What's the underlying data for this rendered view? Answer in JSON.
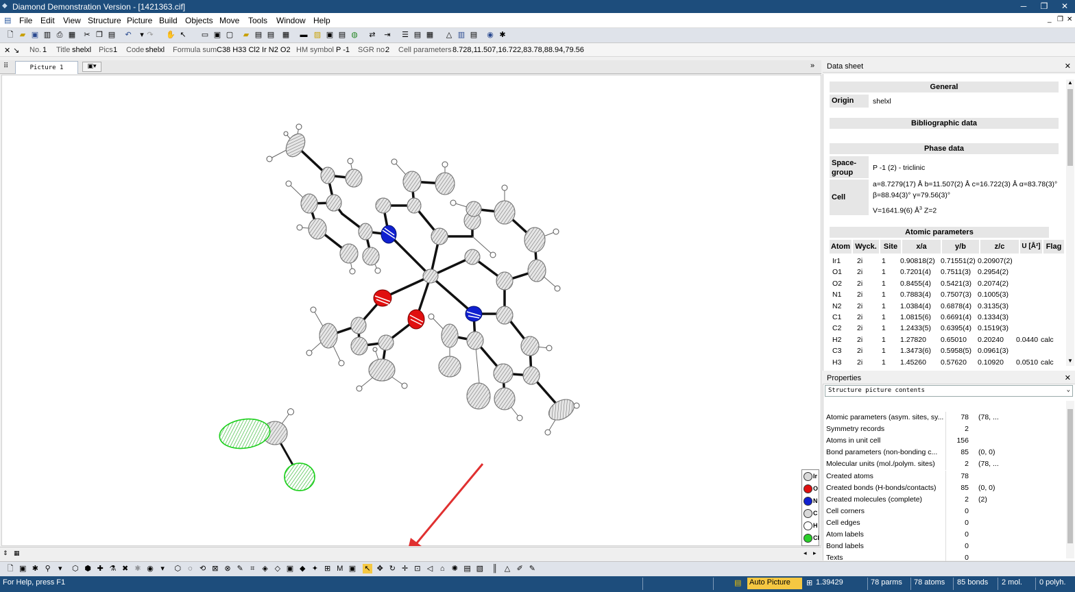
{
  "app": {
    "title": "Diamond Demonstration Version - [1421363.cif]",
    "menu": [
      "File",
      "Edit",
      "View",
      "Structure",
      "Picture",
      "Build",
      "Objects",
      "Move",
      "Tools",
      "Window",
      "Help"
    ]
  },
  "info": {
    "no_label": "No.",
    "no": "1",
    "title_label": "Title",
    "title": "shelxl",
    "pics_label": "Pics",
    "pics": "1",
    "code_label": "Code",
    "code": "shelxl",
    "formula_label": "Formula sum",
    "formula": "C38 H33 Cl2 Ir N2 O2",
    "hm_label": "HM symbol",
    "hm": "P -1",
    "sgr_label": "SGR no.",
    "sgr": "2",
    "cell_label": "Cell parameters",
    "cell": "8.728,11.507,16.722,83.78,88.94,79.56"
  },
  "tab": {
    "label": "Picture 1"
  },
  "datasheet": {
    "title": "Data sheet",
    "general": "General",
    "origin_label": "Origin",
    "origin": "shelxl",
    "biblio": "Bibliographic data",
    "phase": "Phase data",
    "sg_label": "Space-group",
    "sg": "P -1 (2) - triclinic",
    "cell_label": "Cell",
    "cell_line1": "a=8.7279(17) Å b=11.507(2) Å c=16.722(3) Å α=83.78(3)°",
    "cell_line2": "β=88.94(3)° γ=79.56(3)°",
    "cell_line3": "V=1641.9(6) Å",
    "cell_line3_sup": "3",
    "cell_line3_z": " Z=2",
    "atomic": "Atomic parameters",
    "headers": [
      "Atom",
      "Wyck.",
      "Site",
      "x/a",
      "y/b",
      "z/c",
      "U [Å²]",
      "Flag"
    ],
    "rows": [
      [
        "Ir1",
        "2i",
        "1",
        "0.90818(2)",
        "0.71551(2)",
        "0.20907(2)",
        "",
        ""
      ],
      [
        "O1",
        "2i",
        "1",
        "0.7201(4)",
        "0.7511(3)",
        "0.2954(2)",
        "",
        ""
      ],
      [
        "O2",
        "2i",
        "1",
        "0.8455(4)",
        "0.5421(3)",
        "0.2074(2)",
        "",
        ""
      ],
      [
        "N1",
        "2i",
        "1",
        "0.7883(4)",
        "0.7507(3)",
        "0.1005(3)",
        "",
        ""
      ],
      [
        "N2",
        "2i",
        "1",
        "1.0384(4)",
        "0.6878(4)",
        "0.3135(3)",
        "",
        ""
      ],
      [
        "C1",
        "2i",
        "1",
        "1.0815(6)",
        "0.6691(4)",
        "0.1334(3)",
        "",
        ""
      ],
      [
        "C2",
        "2i",
        "1",
        "1.2433(5)",
        "0.6395(4)",
        "0.1519(3)",
        "",
        ""
      ],
      [
        "H2",
        "2i",
        "1",
        "1.27820",
        "0.65010",
        "0.20240",
        "0.0440",
        "calc"
      ],
      [
        "C3",
        "2i",
        "1",
        "1.3473(6)",
        "0.5958(5)",
        "0.0961(3)",
        "",
        ""
      ],
      [
        "H3",
        "2i",
        "1",
        "1.45260",
        "0.57620",
        "0.10920",
        "0.0510",
        "calc"
      ]
    ]
  },
  "properties": {
    "title": "Properties",
    "combo": "Structure picture contents",
    "items": [
      [
        "Atomic parameters (asym. sites, sy...",
        "78",
        "(78, ..."
      ],
      [
        "Symmetry records",
        "2",
        ""
      ],
      [
        "Atoms in unit cell",
        "156",
        ""
      ],
      [
        "Bond parameters (non-bonding c...",
        "85",
        "(0, 0)"
      ],
      [
        "Molecular units (mol./polym. sites)",
        "2",
        "(78, ..."
      ],
      [
        "Created atoms",
        "78",
        ""
      ],
      [
        "Created bonds (H-bonds/contacts)",
        "85",
        "(0, 0)"
      ],
      [
        "Created molecules (complete)",
        "2",
        "(2)"
      ],
      [
        "Cell corners",
        "0",
        ""
      ],
      [
        "Cell edges",
        "0",
        ""
      ],
      [
        "Atom labels",
        "0",
        ""
      ],
      [
        "Bond labels",
        "0",
        ""
      ],
      [
        "Texts",
        "0",
        ""
      ]
    ]
  },
  "legend": [
    {
      "label": "Ir",
      "color": "#d8d8d8"
    },
    {
      "label": "O",
      "color": "#e01010"
    },
    {
      "label": "N",
      "color": "#1020d0"
    },
    {
      "label": "C",
      "color": "#d8d8d8"
    },
    {
      "label": "H",
      "color": "#ffffff"
    },
    {
      "label": "Cl",
      "color": "#2ad02a"
    }
  ],
  "status": {
    "help": "For Help, press F1",
    "mode": "Auto Picture",
    "zoom": "1.39429",
    "parms": "78 parms",
    "atoms": "78 atoms",
    "bonds": "85 bonds",
    "mol": "2 mol.",
    "polyh": "0 polyh."
  },
  "colors": {
    "titlebar": "#1d4d7c",
    "oxygen": "#e01010",
    "nitrogen": "#1020d0",
    "chlorine": "#2ad02a",
    "arrow": "#e03030"
  }
}
